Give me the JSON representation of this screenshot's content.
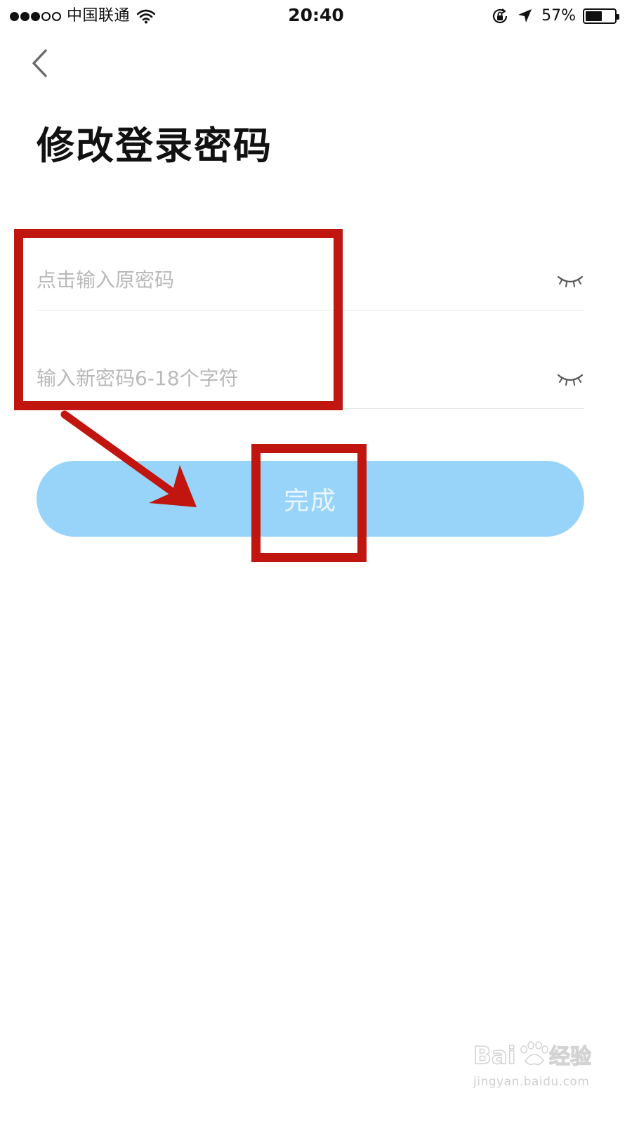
{
  "status_bar": {
    "carrier": "中国联通",
    "time": "20:40",
    "battery_percent": "57%",
    "battery_level": 0.57,
    "signal_bars": 3,
    "signal_total": 5
  },
  "nav": {
    "back_icon": "chevron-left-icon"
  },
  "page": {
    "title": "修改登录密码"
  },
  "form": {
    "old_password": {
      "placeholder": "点击输入原密码",
      "value": "",
      "toggle_icon": "eye-closed-icon"
    },
    "new_password": {
      "placeholder": "输入新密码6-18个字符",
      "value": "",
      "toggle_icon": "eye-closed-icon"
    },
    "submit_label": "完成"
  },
  "annotations": {
    "color": "#c0160f",
    "highlight_inputs": "red-box",
    "highlight_button": "red-box",
    "arrow": "arrow-to-button"
  },
  "watermark": {
    "logo_text": "Baidu经验",
    "url": "jingyan.baidu.com"
  },
  "colors": {
    "button_bg": "#98d4fa",
    "button_text": "#eaf5fd",
    "placeholder": "#b9b9b9",
    "divider": "#e9e9e9"
  }
}
